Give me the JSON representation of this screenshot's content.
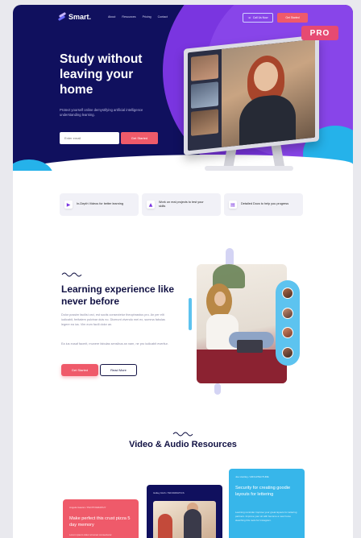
{
  "nav": {
    "logo": "Smart.",
    "links": [
      "About",
      "Resources",
      "Pricing",
      "Contact"
    ],
    "call_label": "Call Us Now",
    "start_label": "Get Started"
  },
  "hero": {
    "title": "Study without leaving your home",
    "subtitle": "Protect yourself online demystifying artificial intelligence understanding learning.",
    "input_placeholder": "Enter email",
    "cta": "Get Started",
    "badge": "PRO"
  },
  "features": [
    {
      "icon": "video-icon",
      "text": "In-Depth Videos for better learning"
    },
    {
      "icon": "flame-icon",
      "text": "Work on real projects to test your skills"
    },
    {
      "icon": "document-icon",
      "text": "Detailed Docs to help you progress"
    }
  ],
  "learning": {
    "title": "Learning experience like never before",
    "p1": "Dolor possim facilisi orci, est sociis consectetur theophrastus pro. An per elit iudicabit, feritatem pulvinar duis no. Dicerunt vivendo mei ex, summa fabulas legere ea ius. Vim eum facili dolor an.",
    "p2": "Ea ius eusaf facerit, munere fabulas sensibus an nam, ne pro iudicabit everitur.",
    "cta": "Get Started",
    "more": "Read More"
  },
  "resources": {
    "title": "Video & Audio Resources",
    "cards": [
      {
        "tag": "Angela Gawan / PHOTOGRAPHY",
        "title": "Make perfect this crust pizza 5 day memory",
        "desc": "Lorem ipsum dolor sit amet consectetur."
      },
      {
        "tag": "Gidley Roth / INFORMATICS"
      },
      {
        "tag": "Joe Huntley / ARCHITECTURE",
        "title": "Security for creating goodie layouts for lettering",
        "desc": "Learning reminder improve your great layouts for lettering partners. Improve your sit with become a new home sketching this tools for Instagram."
      }
    ]
  },
  "colors": {
    "navy": "#10105e",
    "purple": "#7a35e0",
    "coral": "#ef5a6a",
    "sky": "#37b6ea",
    "pro": "#e64a72"
  }
}
